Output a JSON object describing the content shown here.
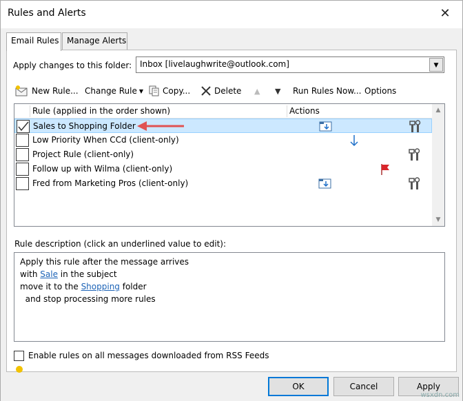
{
  "window": {
    "title": "Rules and Alerts",
    "close_glyph": "✕"
  },
  "tabs": [
    {
      "label": "Email Rules",
      "active": true
    },
    {
      "label": "Manage Alerts",
      "active": false
    }
  ],
  "folder": {
    "label": "Apply changes to this folder:",
    "value": "Inbox [livelaughwrite@outlook.com]"
  },
  "toolbar": {
    "new_rule": "New Rule...",
    "change_rule": "Change Rule",
    "copy": "Copy...",
    "delete": "Delete",
    "run_rules_now": "Run Rules Now...",
    "options": "Options"
  },
  "rules_list": {
    "headers": {
      "rule": "Rule (applied in the order shown)",
      "actions": "Actions"
    },
    "rows": [
      {
        "name": "Sales to Shopping Folder",
        "checked": true,
        "selected": true,
        "icons": [
          "move-to-folder-icon",
          "client-only-tools-icon"
        ]
      },
      {
        "name": "Low Priority When CCd  (client-only)",
        "checked": false,
        "selected": false,
        "icons": [
          "low-priority-arrow-icon"
        ]
      },
      {
        "name": "Project Rule  (client-only)",
        "checked": false,
        "selected": false,
        "icons": [
          "client-only-tools-icon"
        ]
      },
      {
        "name": "Follow up with Wilma  (client-only)",
        "checked": false,
        "selected": false,
        "icons": [
          "flag-icon"
        ]
      },
      {
        "name": "Fred from Marketing Pros  (client-only)",
        "checked": false,
        "selected": false,
        "icons": [
          "move-to-folder-icon",
          "client-only-tools-icon"
        ]
      }
    ]
  },
  "description": {
    "label": "Rule description (click an underlined value to edit):",
    "line1": "Apply this rule after the message arrives",
    "line2_prefix": "with ",
    "line2_link": "Sale",
    "line2_suffix": " in the subject",
    "line3_prefix": "move it to the ",
    "line3_link": "Shopping",
    "line3_suffix": " folder",
    "line4": "  and stop processing more rules"
  },
  "rss": {
    "label": "Enable rules on all messages downloaded from RSS Feeds",
    "checked": false
  },
  "buttons": {
    "ok": "OK",
    "cancel": "Cancel",
    "apply": "Apply"
  },
  "colors": {
    "selection": "#cce8ff",
    "link": "#1c63b7",
    "annotation_arrow": "#e05252",
    "flag": "#d9262b"
  },
  "watermark": "wsxdn.com"
}
